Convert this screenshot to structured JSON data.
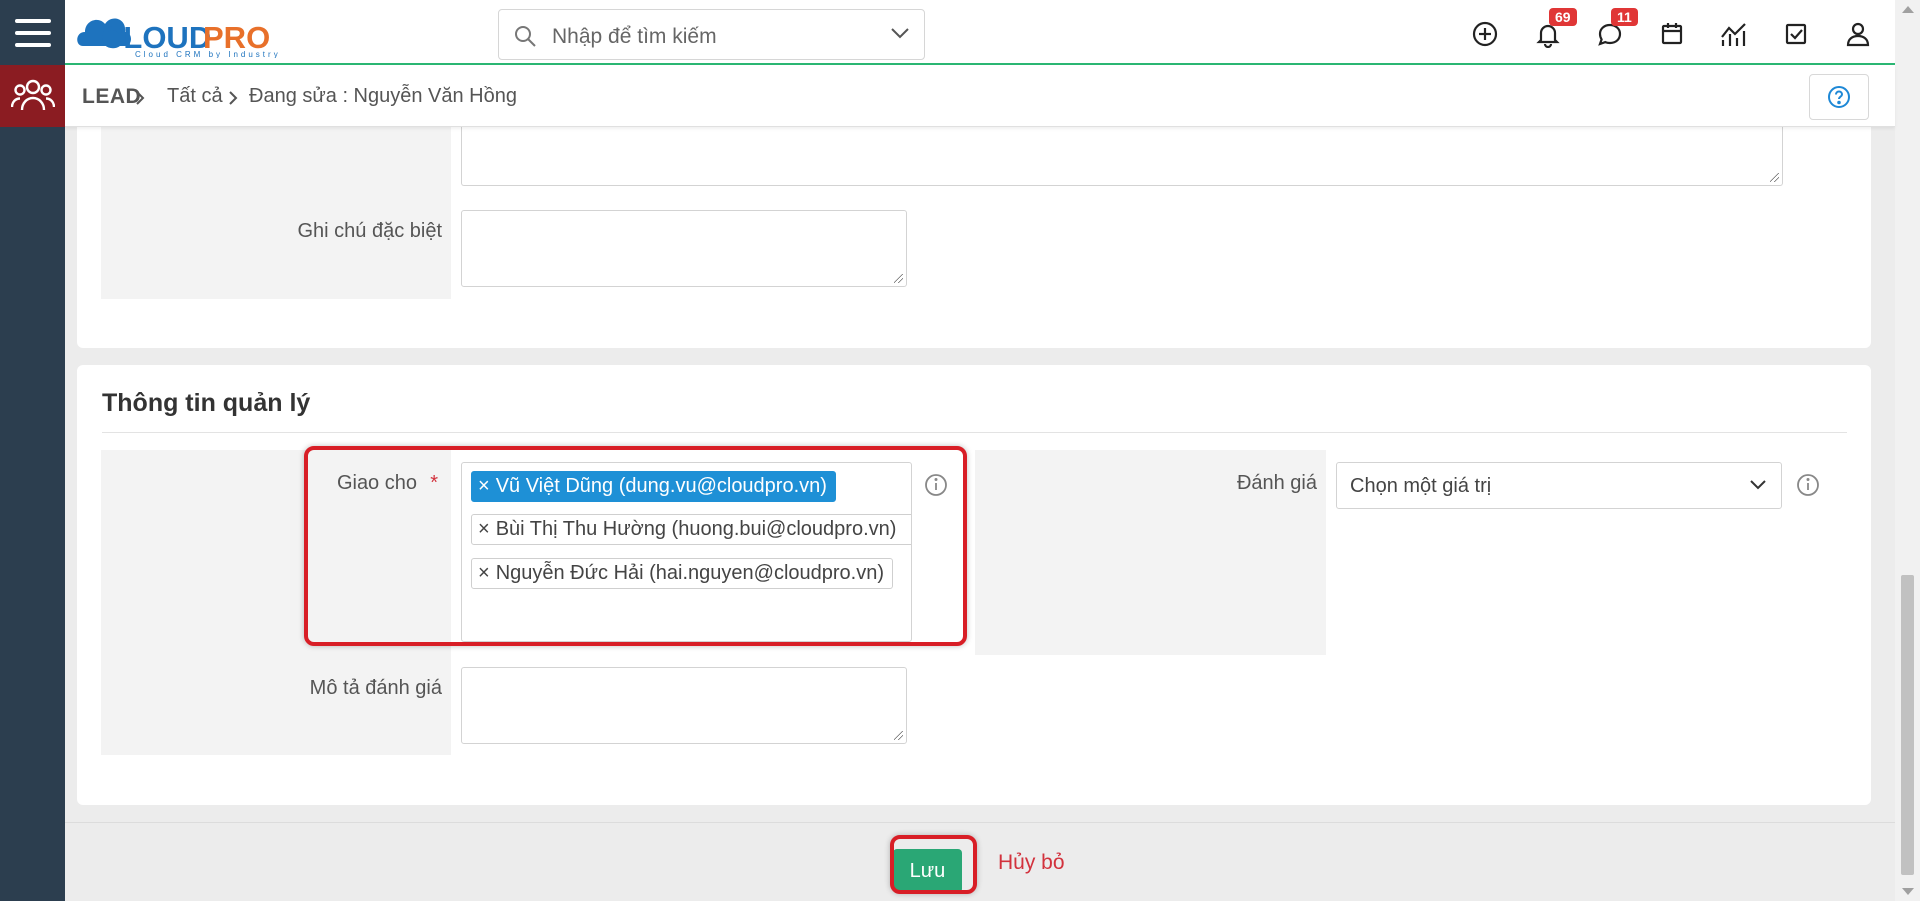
{
  "header": {
    "logo_text": "CLOUDPRO",
    "logo_tagline": "Cloud CRM by Industry",
    "search_placeholder": "Nhập để tìm kiếm",
    "notification_count": "69",
    "message_count": "11"
  },
  "breadcrumb": {
    "module": "LEAD",
    "list": "Tất cả",
    "current": "Đang sửa : Nguyễn Văn Hồng"
  },
  "form": {
    "special_note_label": "Ghi chú đặc biệt",
    "section_title": "Thông tin quản lý",
    "assigned_to_label": "Giao cho",
    "required_mark": "*",
    "assigned_to": [
      {
        "remove": "×",
        "name": "Vũ Việt Dũng (dung.vu@cloudpro.vn)"
      },
      {
        "remove": "×",
        "name": "Bùi Thị Thu Hường (huong.bui@cloudpro.vn)"
      },
      {
        "remove": "×",
        "name": "Nguyễn Đức Hải (hai.nguyen@cloudpro.vn)"
      }
    ],
    "rating_label": "Đánh giá",
    "rating_value": "Chọn một giá trị",
    "rating_desc_label": "Mô tả đánh giá"
  },
  "actions": {
    "save_label": "Lưu",
    "cancel_label": "Hủy bỏ"
  },
  "colors": {
    "sidebar": "#2c3e4f",
    "module_accent": "#8b1c22",
    "save": "#2aa775",
    "cancel": "#d2323d",
    "chip_active": "#1e90d6",
    "highlight": "#d81e26",
    "badge": "#e03636"
  }
}
